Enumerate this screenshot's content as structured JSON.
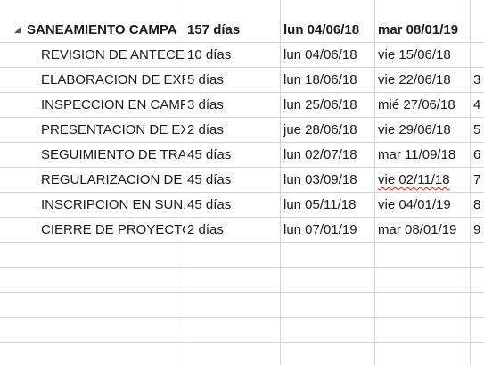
{
  "summary": {
    "name": "SANEAMIENTO CAMPA",
    "duration": "157 días",
    "start": "lun 04/06/18",
    "end": "mar 08/01/19",
    "collapse_icon": "collapse-triangle-icon"
  },
  "tasks": [
    {
      "name": "REVISION DE ANTECEI",
      "duration": "10 días",
      "start": "lun 04/06/18",
      "end": "vie 15/06/18",
      "pred": ""
    },
    {
      "name": "ELABORACION DE EXP",
      "duration": "5 días",
      "start": "lun 18/06/18",
      "end": "vie 22/06/18",
      "pred": "3"
    },
    {
      "name": "INSPECCION EN CAMP",
      "duration": "3 días",
      "start": "lun 25/06/18",
      "end": "mié 27/06/18",
      "pred": "4"
    },
    {
      "name": "PRESENTACION DE EX",
      "duration": "2 días",
      "start": "jue 28/06/18",
      "end": "vie 29/06/18",
      "pred": "5"
    },
    {
      "name": "SEGUIMIENTO DE TRA",
      "duration": "45 días",
      "start": "lun 02/07/18",
      "end": "mar 11/09/18",
      "pred": "6"
    },
    {
      "name": "REGULARIZACION DE",
      "duration": "45 días",
      "start": "lun 03/09/18",
      "end": "vie 02/11/18",
      "pred": "7"
    },
    {
      "name": "INSCRIPCION EN SUN.",
      "duration": "45 días",
      "start": "lun 05/11/18",
      "end": "vie 04/01/19",
      "pred": "8"
    },
    {
      "name": "CIERRE DE PROYECTO",
      "duration": "2 días",
      "start": "lun 07/01/19",
      "end": "mar 08/01/19",
      "pred": "9"
    }
  ]
}
